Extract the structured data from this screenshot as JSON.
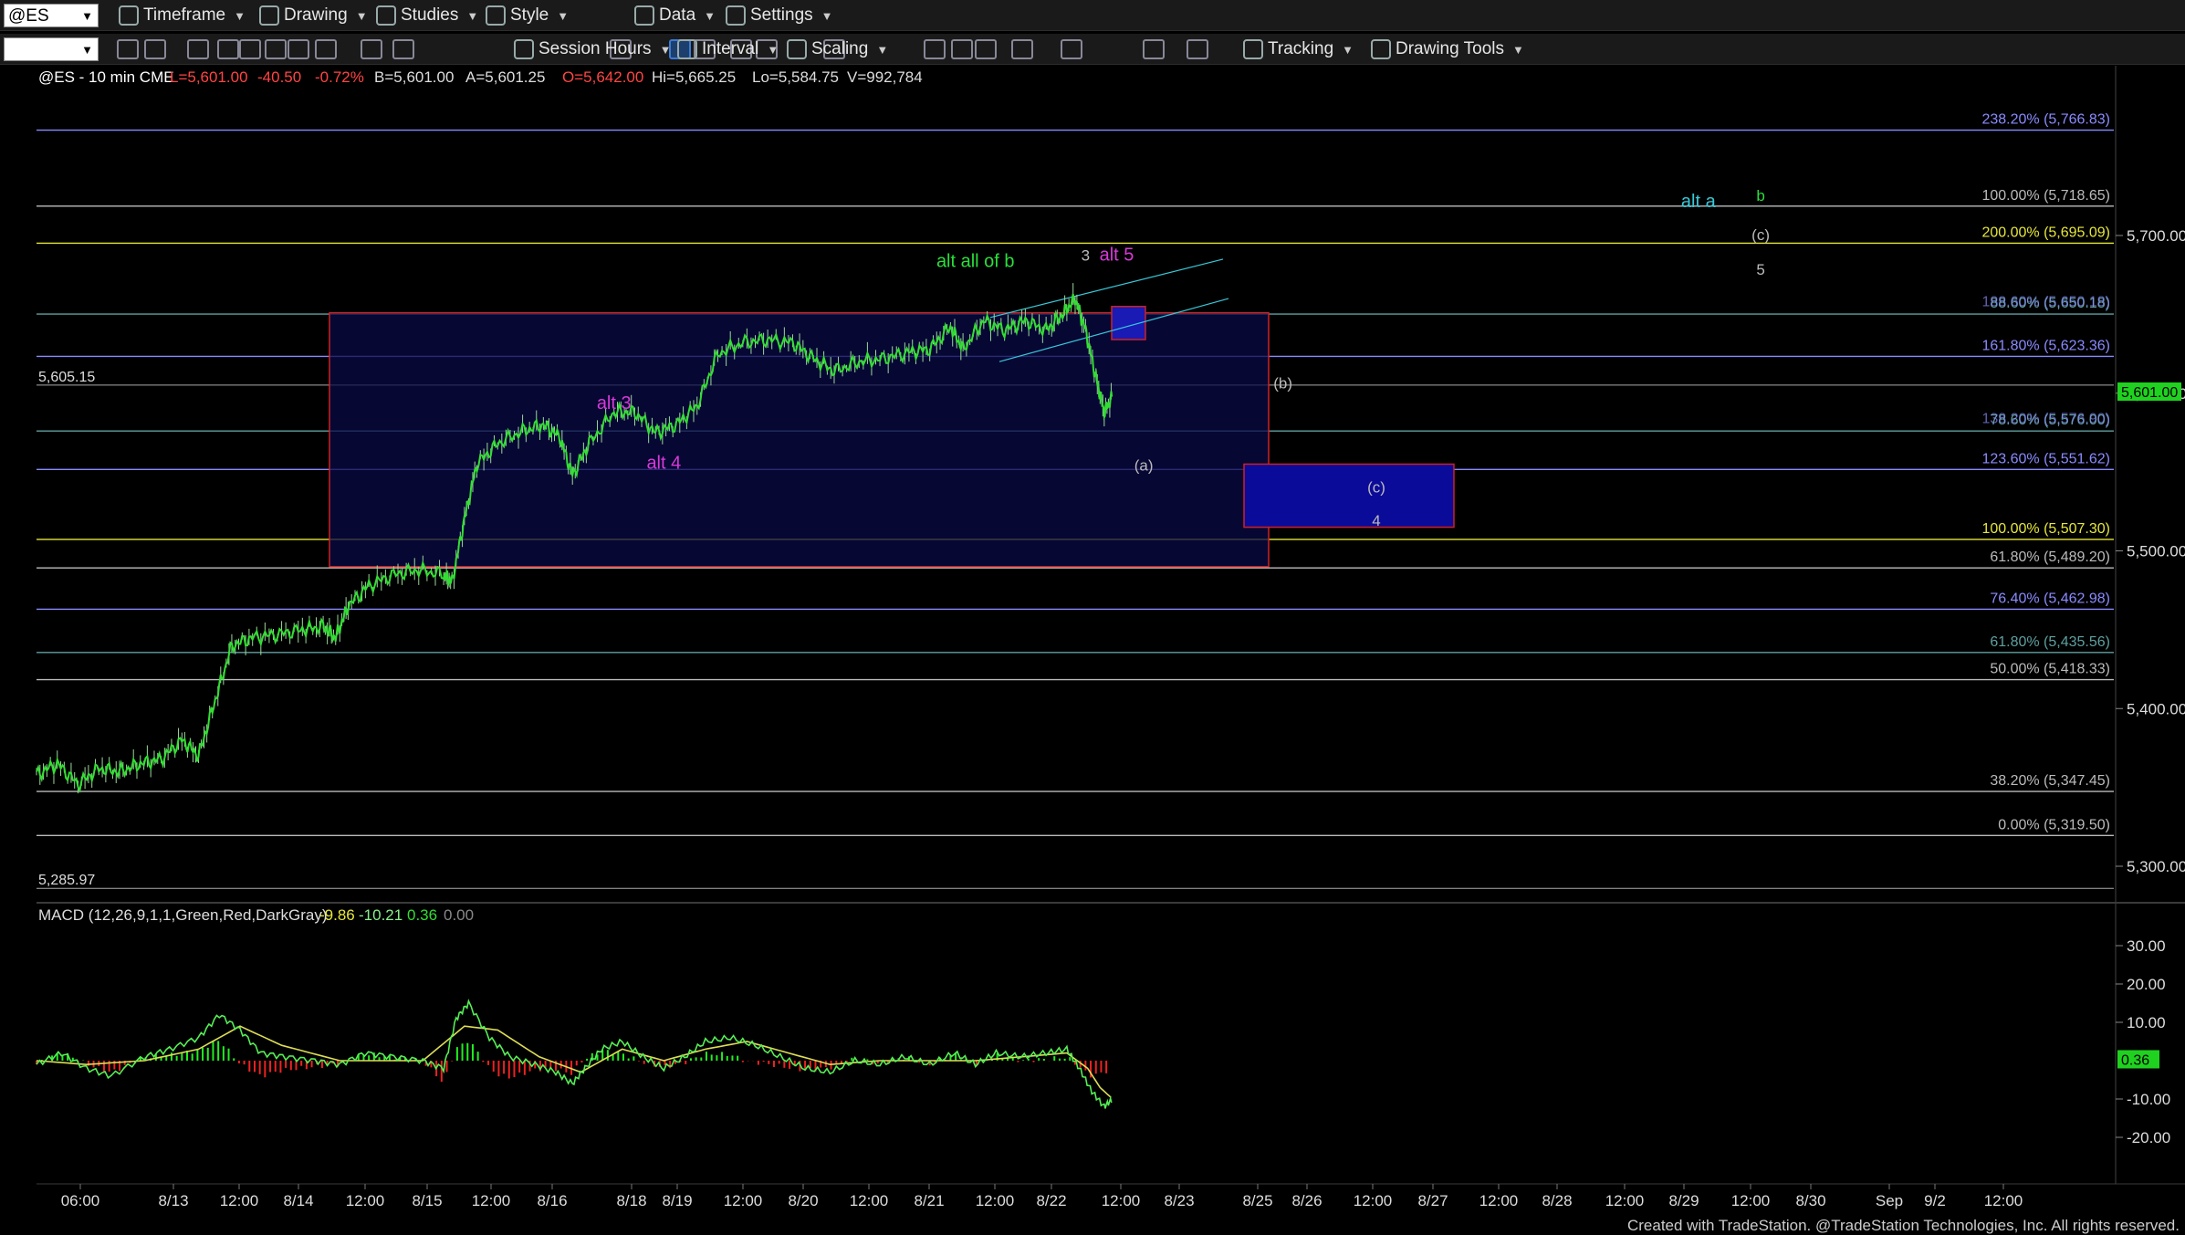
{
  "toolbar1": {
    "symbol": "@ES",
    "items": [
      {
        "name": "timeframe-menu",
        "label": "Timeframe",
        "x": 130
      },
      {
        "name": "drawing-menu",
        "label": "Drawing",
        "x": 284
      },
      {
        "name": "studies-menu",
        "label": "Studies",
        "x": 412
      },
      {
        "name": "style-menu",
        "label": "Style",
        "x": 532
      },
      {
        "name": "data-menu",
        "label": "Data",
        "x": 695
      },
      {
        "name": "settings-menu",
        "label": "Settings",
        "x": 795
      }
    ]
  },
  "toolbar2": {
    "items": [
      {
        "name": "session-hours-menu",
        "label": "Session Hours",
        "x": 563
      },
      {
        "name": "interval-menu",
        "label": "Interval",
        "x": 742
      },
      {
        "name": "scaling-menu",
        "label": "Scaling",
        "x": 862
      },
      {
        "name": "tracking-menu",
        "label": "Tracking",
        "x": 1362
      },
      {
        "name": "drawing-tools-menu",
        "label": "Drawing Tools",
        "x": 1502
      }
    ]
  },
  "header": {
    "title": "@ES - 10 min  CME",
    "last": "L=5,601.00",
    "change": "-40.50",
    "pct": "-0.72%",
    "bid": "B=5,601.00",
    "ask": "A=5,601.25",
    "open": "O=5,642.00",
    "high": "Hi=5,665.25",
    "low": "Lo=5,584.75",
    "volume": "V=992,784"
  },
  "colors": {
    "background": "#000000",
    "candle": "#33dd33",
    "fib_yellow": "#e6e63a",
    "fib_blue": "#8a8aff",
    "fib_gray": "#bbbbbb",
    "fib_teal": "#5f9f9f",
    "wave_green": "#2adf3a",
    "wave_magenta": "#d93ad9",
    "wave_cyan": "#37c8d8",
    "box_red": "#cc2222",
    "box_blue": "#0b0b9a",
    "current_price_bg": "#1fd21f"
  },
  "chart_data": {
    "type": "candlestick",
    "price_axis": {
      "ticks": [
        "5,700.00",
        "5,600.00",
        "5,500.00",
        "5,400.00",
        "5,300.00"
      ],
      "tick_values": [
        5700,
        5600,
        5500,
        5400,
        5300
      ],
      "current_price_label": "5,601.00",
      "current_price": 5601.0,
      "ylim": [
        5250,
        5800
      ]
    },
    "left_price_labels": [
      {
        "text": "5,605.15",
        "value": 5605.15
      },
      {
        "text": "5,285.97",
        "value": 5285.97
      }
    ],
    "time_axis": {
      "labels": [
        "06:00",
        "8/13",
        "12:00",
        "8/14",
        "12:00",
        "8/15",
        "12:00",
        "8/16",
        "8/18",
        "8/19",
        "12:00",
        "8/20",
        "12:00",
        "8/21",
        "12:00",
        "8/22",
        "12:00",
        "8/23",
        "8/25",
        "8/26",
        "12:00",
        "8/27",
        "12:00",
        "8/28",
        "12:00",
        "8/29",
        "12:00",
        "8/30",
        "Sep",
        "9/2",
        "12:00"
      ]
    },
    "fib_levels": [
      {
        "label": "238.20% (5,766.83)",
        "value": 5766.83,
        "color": "#8a8aff"
      },
      {
        "label": "100.00% (5,718.65)",
        "value": 5718.65,
        "color": "#bbbbbb"
      },
      {
        "label": "200.00% (5,695.09)",
        "value": 5695.09,
        "color": "#e6e63a"
      },
      {
        "label": "88.60% (5,650.18)",
        "value": 5650.18,
        "color": "#5f9f9f"
      },
      {
        "label": "161.80% (5,623.36)",
        "value": 5623.36,
        "color": "#8a8aff"
      },
      {
        "label": "78.60% (5,576.00)",
        "value": 5576.0,
        "color": "#5f9f9f"
      },
      {
        "label": "123.60% (5,551.62)",
        "value": 5551.62,
        "color": "#8a8aff"
      },
      {
        "label": "100.00% (5,507.30)",
        "value": 5507.3,
        "color": "#e6e63a"
      },
      {
        "label": "61.80% (5,489.20)",
        "value": 5489.2,
        "color": "#bbbbbb"
      },
      {
        "label": "76.40% (5,462.98)",
        "value": 5462.98,
        "color": "#8a8aff"
      },
      {
        "label": "61.80% (5,435.56)",
        "value": 5435.56,
        "color": "#5f9f9f"
      },
      {
        "label": "50.00% (5,418.33)",
        "value": 5418.33,
        "color": "#bbbbbb"
      },
      {
        "label": "38.20% (5,347.45)",
        "value": 5347.45,
        "color": "#bbbbbb"
      },
      {
        "label": "0.00% (5,319.50)",
        "value": 5319.5,
        "color": "#bbbbbb"
      }
    ],
    "overlapped_labels": [
      {
        "label": "188.60% (5,650.18)",
        "value": 5651.0,
        "color": "#8a8aff"
      },
      {
        "label": "138.20% (5,576.90)",
        "value": 5577.0,
        "color": "#8a8aff"
      }
    ],
    "wave_labels": [
      {
        "text": "alt all of b",
        "color": "#2adf3a",
        "time": 0.452,
        "value": 5680
      },
      {
        "text": "3",
        "color": "#bbbbbb",
        "time": 0.505,
        "value": 5684
      },
      {
        "text": "alt 5",
        "color": "#d93ad9",
        "time": 0.52,
        "value": 5684
      },
      {
        "text": "alt 3",
        "color": "#d93ad9",
        "time": 0.278,
        "value": 5590
      },
      {
        "text": "alt 4",
        "color": "#d93ad9",
        "time": 0.302,
        "value": 5552
      },
      {
        "text": "(b)",
        "color": "#bbbbbb",
        "time": 0.6,
        "value": 5603
      },
      {
        "text": "(a)",
        "color": "#bbbbbb",
        "time": 0.533,
        "value": 5551
      },
      {
        "text": "(c)",
        "color": "#bbbbbb",
        "time": 0.645,
        "value": 5537
      },
      {
        "text": "4",
        "color": "#bbbbbb",
        "time": 0.645,
        "value": 5516
      },
      {
        "text": "alt a",
        "color": "#37c8d8",
        "time": 0.8,
        "value": 5718
      },
      {
        "text": "b",
        "color": "#2adf3a",
        "time": 0.83,
        "value": 5722
      },
      {
        "text": "(c)",
        "color": "#bbbbbb",
        "time": 0.83,
        "value": 5697
      },
      {
        "text": "5",
        "color": "#bbbbbb",
        "time": 0.83,
        "value": 5675
      }
    ],
    "macd": {
      "label": "MACD (12,26,9,1,1,Green,Red,DarkGray)",
      "values_text": [
        "-9.86",
        "-10.21",
        "0.36",
        "0.00"
      ],
      "macd": -9.86,
      "signal": -10.21,
      "histogram": 0.36,
      "zero": 0.0,
      "ticks": [
        "30.00",
        "20.00",
        "10.00",
        "-10.00",
        "-20.00"
      ],
      "tick_values": [
        30,
        20,
        10,
        -10,
        -20
      ],
      "current_label": "0.36",
      "ylim": [
        -30,
        35
      ]
    },
    "price_path": [
      [
        0.0,
        5358
      ],
      [
        0.01,
        5365
      ],
      [
        0.02,
        5352
      ],
      [
        0.03,
        5362
      ],
      [
        0.04,
        5360
      ],
      [
        0.05,
        5365
      ],
      [
        0.06,
        5368
      ],
      [
        0.07,
        5380
      ],
      [
        0.078,
        5370
      ],
      [
        0.086,
        5405
      ],
      [
        0.094,
        5440
      ],
      [
        0.104,
        5445
      ],
      [
        0.116,
        5447
      ],
      [
        0.128,
        5450
      ],
      [
        0.138,
        5452
      ],
      [
        0.144,
        5445
      ],
      [
        0.15,
        5465
      ],
      [
        0.16,
        5478
      ],
      [
        0.172,
        5485
      ],
      [
        0.184,
        5488
      ],
      [
        0.196,
        5485
      ],
      [
        0.2,
        5480
      ],
      [
        0.206,
        5520
      ],
      [
        0.212,
        5555
      ],
      [
        0.222,
        5568
      ],
      [
        0.234,
        5576
      ],
      [
        0.244,
        5580
      ],
      [
        0.252,
        5572
      ],
      [
        0.258,
        5548
      ],
      [
        0.266,
        5568
      ],
      [
        0.278,
        5588
      ],
      [
        0.288,
        5588
      ],
      [
        0.298,
        5575
      ],
      [
        0.308,
        5580
      ],
      [
        0.318,
        5592
      ],
      [
        0.328,
        5625
      ],
      [
        0.34,
        5632
      ],
      [
        0.352,
        5634
      ],
      [
        0.364,
        5632
      ],
      [
        0.374,
        5622
      ],
      [
        0.384,
        5614
      ],
      [
        0.396,
        5620
      ],
      [
        0.408,
        5622
      ],
      [
        0.42,
        5626
      ],
      [
        0.43,
        5628
      ],
      [
        0.44,
        5642
      ],
      [
        0.446,
        5628
      ],
      [
        0.456,
        5646
      ],
      [
        0.466,
        5640
      ],
      [
        0.476,
        5646
      ],
      [
        0.486,
        5640
      ],
      [
        0.494,
        5650
      ],
      [
        0.5,
        5660
      ],
      [
        0.505,
        5640
      ],
      [
        0.51,
        5610
      ],
      [
        0.514,
        5588
      ],
      [
        0.518,
        5598
      ]
    ],
    "macd_path": [
      [
        0.0,
        -1
      ],
      [
        0.012,
        2
      ],
      [
        0.024,
        -2
      ],
      [
        0.036,
        -4
      ],
      [
        0.052,
        1
      ],
      [
        0.064,
        3
      ],
      [
        0.078,
        6
      ],
      [
        0.088,
        12
      ],
      [
        0.098,
        8
      ],
      [
        0.108,
        2
      ],
      [
        0.12,
        1
      ],
      [
        0.134,
        0
      ],
      [
        0.146,
        -1
      ],
      [
        0.158,
        2
      ],
      [
        0.172,
        1
      ],
      [
        0.186,
        0
      ],
      [
        0.196,
        -2
      ],
      [
        0.202,
        11
      ],
      [
        0.208,
        15
      ],
      [
        0.218,
        6
      ],
      [
        0.228,
        1
      ],
      [
        0.24,
        -1
      ],
      [
        0.25,
        -3
      ],
      [
        0.258,
        -6
      ],
      [
        0.264,
        -2
      ],
      [
        0.272,
        3
      ],
      [
        0.282,
        5
      ],
      [
        0.292,
        1
      ],
      [
        0.302,
        -2
      ],
      [
        0.312,
        1
      ],
      [
        0.322,
        5
      ],
      [
        0.334,
        6
      ],
      [
        0.346,
        4
      ],
      [
        0.358,
        1
      ],
      [
        0.37,
        -2
      ],
      [
        0.382,
        -3
      ],
      [
        0.394,
        0
      ],
      [
        0.406,
        -1
      ],
      [
        0.418,
        1
      ],
      [
        0.43,
        -1
      ],
      [
        0.442,
        2
      ],
      [
        0.452,
        -1
      ],
      [
        0.462,
        2
      ],
      [
        0.474,
        1
      ],
      [
        0.486,
        2
      ],
      [
        0.496,
        3
      ],
      [
        0.502,
        -2
      ],
      [
        0.508,
        -8
      ],
      [
        0.514,
        -12
      ],
      [
        0.518,
        -10
      ]
    ],
    "signal_path": [
      [
        0.0,
        0
      ],
      [
        0.024,
        -1
      ],
      [
        0.052,
        0
      ],
      [
        0.078,
        3
      ],
      [
        0.098,
        9
      ],
      [
        0.118,
        4
      ],
      [
        0.146,
        0
      ],
      [
        0.186,
        0
      ],
      [
        0.206,
        9
      ],
      [
        0.222,
        8
      ],
      [
        0.242,
        1
      ],
      [
        0.262,
        -3
      ],
      [
        0.282,
        3
      ],
      [
        0.302,
        0
      ],
      [
        0.322,
        3
      ],
      [
        0.342,
        5
      ],
      [
        0.362,
        2
      ],
      [
        0.382,
        -1
      ],
      [
        0.406,
        0
      ],
      [
        0.43,
        0
      ],
      [
        0.452,
        0
      ],
      [
        0.474,
        1
      ],
      [
        0.496,
        2
      ],
      [
        0.506,
        -2
      ],
      [
        0.512,
        -7
      ],
      [
        0.518,
        -10
      ]
    ]
  },
  "footer": "Created with TradeStation. @TradeStation Technologies, Inc. All rights reserved."
}
